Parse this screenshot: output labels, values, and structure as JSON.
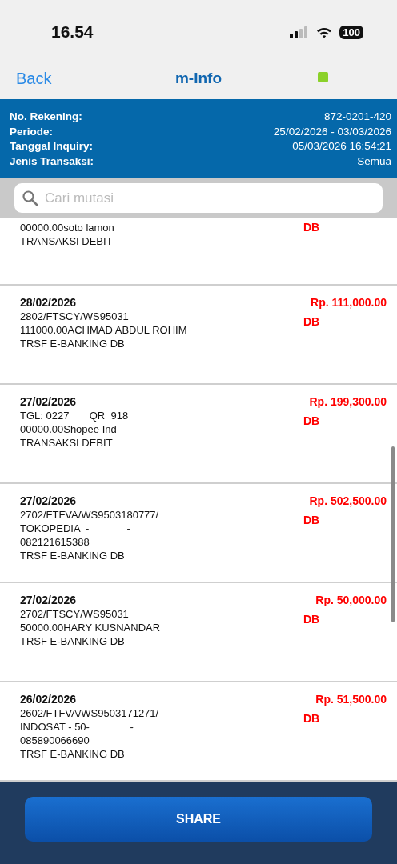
{
  "status_bar": {
    "time": "16.54",
    "battery": "100"
  },
  "nav": {
    "back": "Back",
    "title": "m-Info"
  },
  "account_info": [
    {
      "label": "No. Rekening:",
      "value": "872-0201-420"
    },
    {
      "label": "Periode:",
      "value": "25/02/2026 - 03/03/2026"
    },
    {
      "label": "Tanggal Inquiry:",
      "value": "05/03/2026 16:54:21"
    },
    {
      "label": "Jenis Transaksi:",
      "value": "Semua"
    }
  ],
  "search": {
    "placeholder": "Cari mutasi"
  },
  "transactions": [
    {
      "lines": [
        "00000.00soto lamon",
        "TRANSAKSI DEBIT"
      ],
      "type": "DB"
    },
    {
      "date": "28/02/2026",
      "lines": [
        "2802/FTSCY/WS95031",
        "111000.00ACHMAD ABDUL ROHIM",
        "TRSF E-BANKING DB"
      ],
      "amount": "Rp. 111,000.00",
      "type": "DB"
    },
    {
      "date": "27/02/2026",
      "lines": [
        "TGL: 0227       QR  918",
        "00000.00Shopee Ind",
        "TRANSAKSI DEBIT"
      ],
      "amount": "Rp. 199,300.00",
      "type": "DB"
    },
    {
      "date": "27/02/2026",
      "lines": [
        "2702/FTFVA/WS9503180777/",
        "TOKOPEDIA  -             -",
        "082121615388",
        "TRSF E-BANKING DB"
      ],
      "amount": "Rp. 502,500.00",
      "type": "DB"
    },
    {
      "date": "27/02/2026",
      "lines": [
        "2702/FTSCY/WS95031",
        "50000.00HARY KUSNANDAR",
        "TRSF E-BANKING DB"
      ],
      "amount": "Rp. 50,000.00",
      "type": "DB"
    },
    {
      "date": "26/02/2026",
      "lines": [
        "2602/FTFVA/WS9503171271/",
        "INDOSAT - 50-              -",
        "085890066690",
        "TRSF E-BANKING DB"
      ],
      "amount": "Rp. 51,500.00",
      "type": "DB"
    }
  ],
  "footer": {
    "button": "SHARE"
  }
}
